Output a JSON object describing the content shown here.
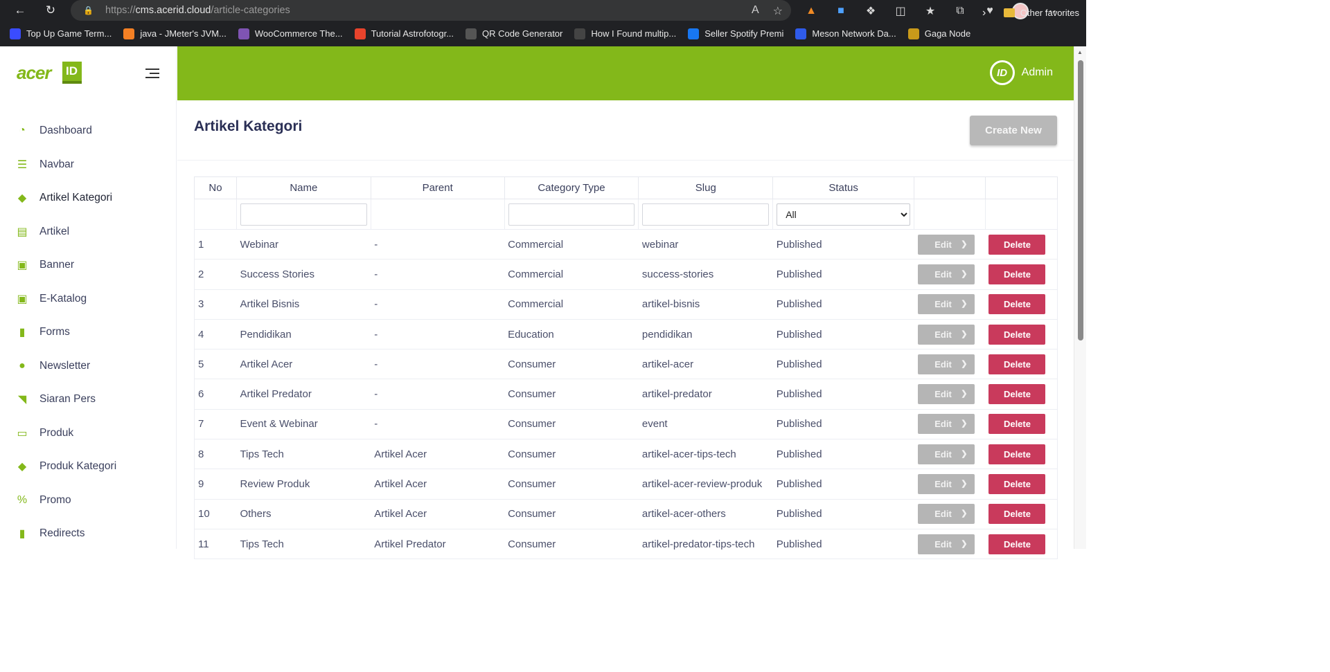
{
  "browser": {
    "url_prefix": "https://",
    "url_host": "cms.acerid.cloud",
    "url_path": "/article-categories"
  },
  "bookmarks": [
    {
      "label": "Top Up Game Term...",
      "color": "#3a4cff",
      "icon": "game-icon"
    },
    {
      "label": "java - JMeter's JVM...",
      "color": "#f48024",
      "icon": "stackoverflow-icon"
    },
    {
      "label": "WooCommerce The...",
      "color": "#7f54b3",
      "icon": "woocommerce-icon"
    },
    {
      "label": "Tutorial Astrofotogr...",
      "color": "#e8432c",
      "icon": "astro-icon"
    },
    {
      "label": "QR Code Generator",
      "color": "#555555",
      "icon": "qr-icon"
    },
    {
      "label": "How I Found multip...",
      "color": "#444444",
      "icon": "document-icon"
    },
    {
      "label": "Seller Spotify Premi",
      "color": "#1877f2",
      "icon": "facebook-icon"
    },
    {
      "label": "Meson Network Da...",
      "color": "#2f5bea",
      "icon": "meson-icon"
    },
    {
      "label": "Gaga Node",
      "color": "#c99a1a",
      "icon": "gaga-icon"
    }
  ],
  "other_favorites": "Other favorites",
  "sidebar": {
    "brand": "acer",
    "brand_badge": "ID",
    "items": [
      {
        "label": "Dashboard",
        "icon": "pie-chart-icon"
      },
      {
        "label": "Navbar",
        "icon": "list-icon"
      },
      {
        "label": "Artikel Kategori",
        "icon": "tag-icon"
      },
      {
        "label": "Artikel",
        "icon": "newspaper-icon"
      },
      {
        "label": "Banner",
        "icon": "images-icon"
      },
      {
        "label": "E-Katalog",
        "icon": "images-icon"
      },
      {
        "label": "Forms",
        "icon": "file-icon"
      },
      {
        "label": "Newsletter",
        "icon": "user-icon"
      },
      {
        "label": "Siaran Pers",
        "icon": "rss-icon"
      },
      {
        "label": "Produk",
        "icon": "laptop-icon"
      },
      {
        "label": "Produk Kategori",
        "icon": "tag-icon"
      },
      {
        "label": "Promo",
        "icon": "percent-icon"
      },
      {
        "label": "Redirects",
        "icon": "file-icon"
      }
    ]
  },
  "header": {
    "user": "Admin",
    "user_logo": "ID",
    "accent": "#83b81a"
  },
  "page": {
    "title": "Artikel Kategori",
    "create_label": "Create New"
  },
  "table": {
    "columns": [
      "No",
      "Name",
      "Parent",
      "Category Type",
      "Slug",
      "Status"
    ],
    "status_filter": "All",
    "edit_label": "Edit",
    "delete_label": "Delete",
    "rows": [
      {
        "no": "1",
        "name": "Webinar",
        "parent": "-",
        "type": "Commercial",
        "slug": "webinar",
        "status": "Published"
      },
      {
        "no": "2",
        "name": "Success Stories",
        "parent": "-",
        "type": "Commercial",
        "slug": "success-stories",
        "status": "Published"
      },
      {
        "no": "3",
        "name": "Artikel Bisnis",
        "parent": "-",
        "type": "Commercial",
        "slug": "artikel-bisnis",
        "status": "Published"
      },
      {
        "no": "4",
        "name": "Pendidikan",
        "parent": "-",
        "type": "Education",
        "slug": "pendidikan",
        "status": "Published"
      },
      {
        "no": "5",
        "name": "Artikel Acer",
        "parent": "-",
        "type": "Consumer",
        "slug": "artikel-acer",
        "status": "Published"
      },
      {
        "no": "6",
        "name": "Artikel Predator",
        "parent": "-",
        "type": "Consumer",
        "slug": "artikel-predator",
        "status": "Published"
      },
      {
        "no": "7",
        "name": "Event & Webinar",
        "parent": "-",
        "type": "Consumer",
        "slug": "event",
        "status": "Published"
      },
      {
        "no": "8",
        "name": "Tips Tech",
        "parent": "Artikel Acer",
        "type": "Consumer",
        "slug": "artikel-acer-tips-tech",
        "status": "Published"
      },
      {
        "no": "9",
        "name": "Review Produk",
        "parent": "Artikel Acer",
        "type": "Consumer",
        "slug": "artikel-acer-review-produk",
        "status": "Published"
      },
      {
        "no": "10",
        "name": "Others",
        "parent": "Artikel Acer",
        "type": "Consumer",
        "slug": "artikel-acer-others",
        "status": "Published"
      },
      {
        "no": "11",
        "name": "Tips Tech",
        "parent": "Artikel Predator",
        "type": "Consumer",
        "slug": "artikel-predator-tips-tech",
        "status": "Published"
      }
    ]
  }
}
